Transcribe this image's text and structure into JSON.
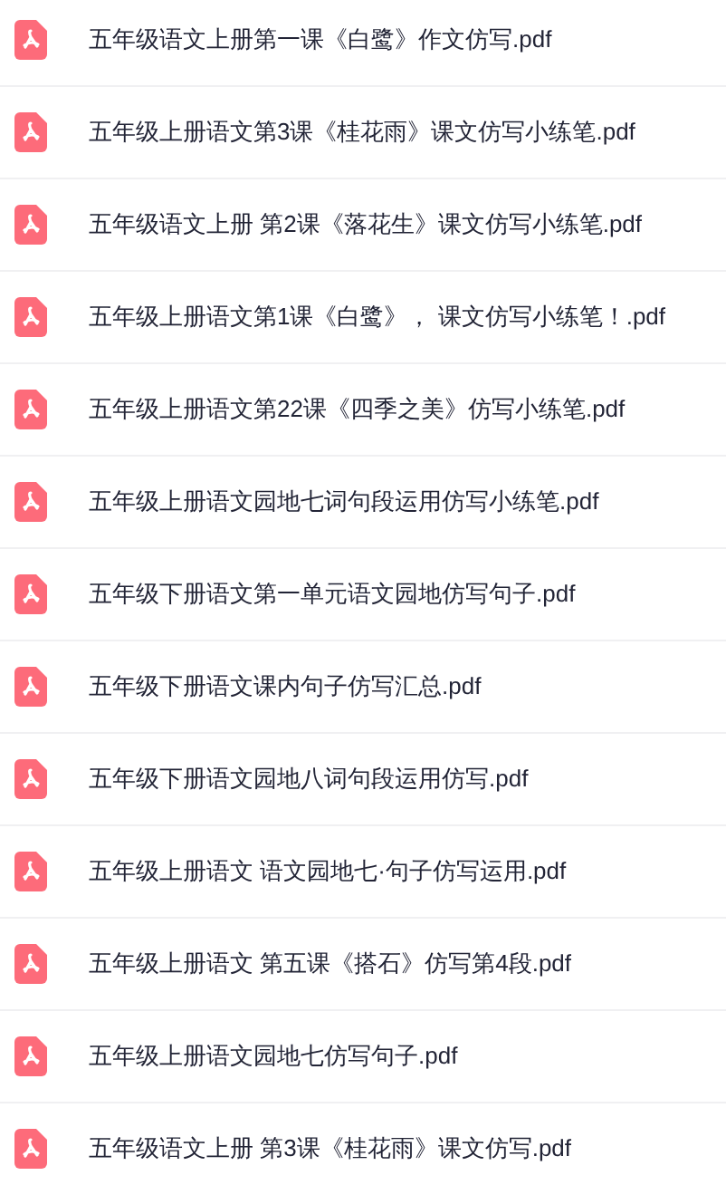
{
  "files": [
    {
      "name": "五年级语文上册第一课《白鹭》作文仿写.pdf"
    },
    {
      "name": "五年级上册语文第3课《桂花雨》课文仿写小练笔.pdf"
    },
    {
      "name": "五年级语文上册 第2课《落花生》课文仿写小练笔.pdf"
    },
    {
      "name": "五年级上册语文第1课《白鹭》， 课文仿写小练笔！.pdf"
    },
    {
      "name": "五年级上册语文第22课《四季之美》仿写小练笔.pdf"
    },
    {
      "name": "五年级上册语文园地七词句段运用仿写小练笔.pdf"
    },
    {
      "name": "五年级下册语文第一单元语文园地仿写句子.pdf"
    },
    {
      "name": "五年级下册语文课内句子仿写汇总.pdf"
    },
    {
      "name": "五年级下册语文园地八词句段运用仿写.pdf"
    },
    {
      "name": "五年级上册语文 语文园地七·句子仿写运用.pdf"
    },
    {
      "name": "五年级上册语文 第五课《搭石》仿写第4段.pdf"
    },
    {
      "name": "五年级上册语文园地七仿写句子.pdf"
    },
    {
      "name": "五年级语文上册 第3课《桂花雨》课文仿写.pdf"
    }
  ]
}
